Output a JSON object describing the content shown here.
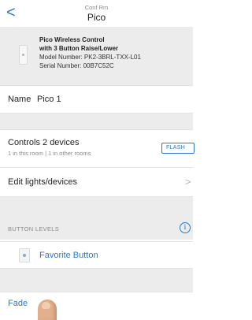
{
  "header": {
    "back_glyph": "<",
    "subtitle": "Conf Rm",
    "title": "Pico"
  },
  "device": {
    "line1": "Pico Wireless Control",
    "line2": "with 3 Button Raise/Lower",
    "model": "Model Number: PK2-3BRL-TXX-L01",
    "serial": "Serial Number: 00B7C52C"
  },
  "name_row": {
    "label": "Name",
    "value": "Pico 1"
  },
  "controls": {
    "title": "Controls 2 devices",
    "subtitle": "1 in this room | 1 in other rooms",
    "flash_label": "FLASH"
  },
  "edit": {
    "label": "Edit lights/devices",
    "chevron": ">"
  },
  "levels": {
    "section_label": "BUTTON LEVELS",
    "info_glyph": "i"
  },
  "favorite": {
    "label": "Favorite Button"
  },
  "fade": {
    "label": "Fade"
  },
  "colors": {
    "accent": "#2a78c8",
    "section_bg": "#ececec",
    "muted_text": "#8a8a8a"
  }
}
